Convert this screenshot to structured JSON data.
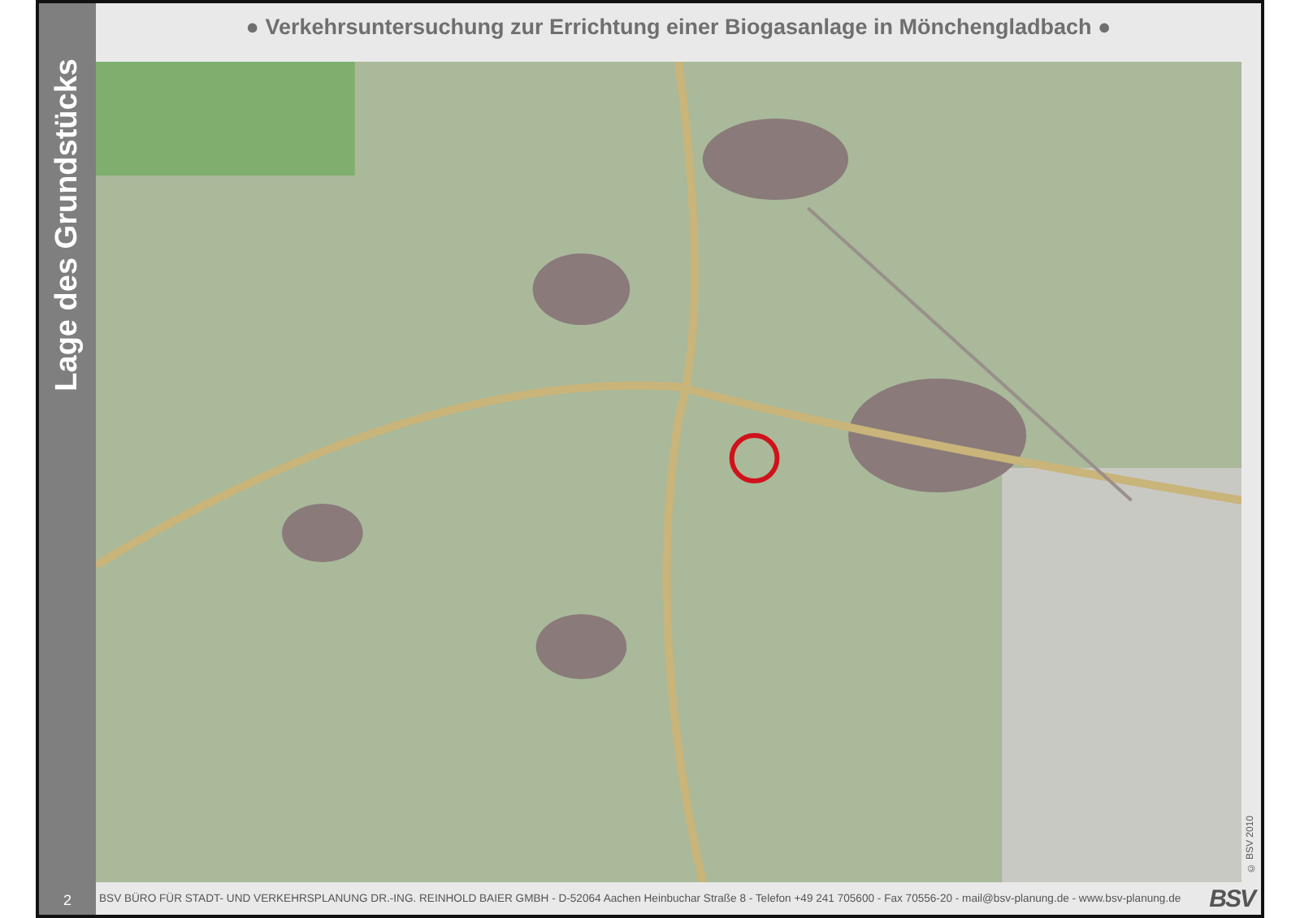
{
  "title": "● Verkehrsuntersuchung zur Errichtung einer Biogasanlage in Mönchengladbach ●",
  "sidebar": {
    "heading": "Lage des Grundstücks",
    "page_number": "2"
  },
  "map": {
    "copyright": "© BSV 2010"
  },
  "footer": {
    "text": "BSV BÜRO FÜR STADT- UND VERKEHRSPLANUNG DR.-ING. REINHOLD BAIER GMBH - D-52064 Aachen Heinbuchar Straße 8 - Telefon +49 241 705600 - Fax 70556-20 - mail@bsv-planung.de - www.bsv-planung.de",
    "logo": "BSV"
  }
}
